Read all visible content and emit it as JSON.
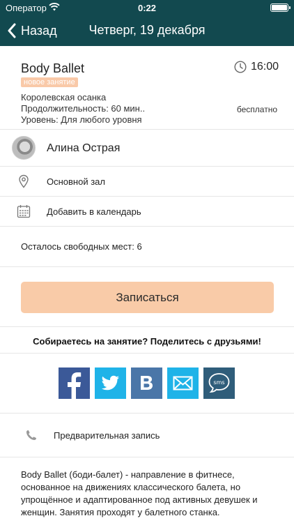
{
  "status_bar": {
    "carrier": "Оператор",
    "time": "0:22"
  },
  "nav": {
    "back_label": "Назад",
    "title": "Четверг, 19 декабря"
  },
  "class": {
    "name": "Body Ballet",
    "badge": "новое занятие",
    "start_time": "16:00",
    "subtitle": "Королевская осанка",
    "duration": "Продолжительность: 60 мин..",
    "level": "Уровень: Для любого уровня",
    "price": "бесплатно"
  },
  "trainer": {
    "name": "Алина Острая"
  },
  "hall": {
    "label": "Основной зал"
  },
  "calendar": {
    "label": "Добавить в календарь"
  },
  "seats": {
    "label": "Осталось свободных мест: 6"
  },
  "signup": {
    "label": "Записаться"
  },
  "share": {
    "title": "Собираетесь на занятие? Поделитесь с друзьями!",
    "buttons": [
      {
        "network": "facebook",
        "icon": "facebook-icon",
        "color": "#3b5998"
      },
      {
        "network": "twitter",
        "icon": "twitter-icon",
        "color": "#1fb3e8"
      },
      {
        "network": "vk",
        "icon": "vk-icon",
        "color": "#4a76a8"
      },
      {
        "network": "email",
        "icon": "mail-icon",
        "color": "#1fb3e8"
      },
      {
        "network": "sms",
        "icon": "sms-icon",
        "color": "#2f5d7a",
        "text": "sms"
      }
    ]
  },
  "prebook": {
    "label": "Предварительная запись"
  },
  "description": "Body Ballet (боди-балет) - направление в фитнесе, основанное на движениях классического балета, но упрощённое и адаптированное под активных девушек и женщин. Занятия проходят у балетного станка.",
  "colors": {
    "header": "#12494f",
    "accent": "#f9cba8",
    "badge": "#f9c9a8"
  }
}
